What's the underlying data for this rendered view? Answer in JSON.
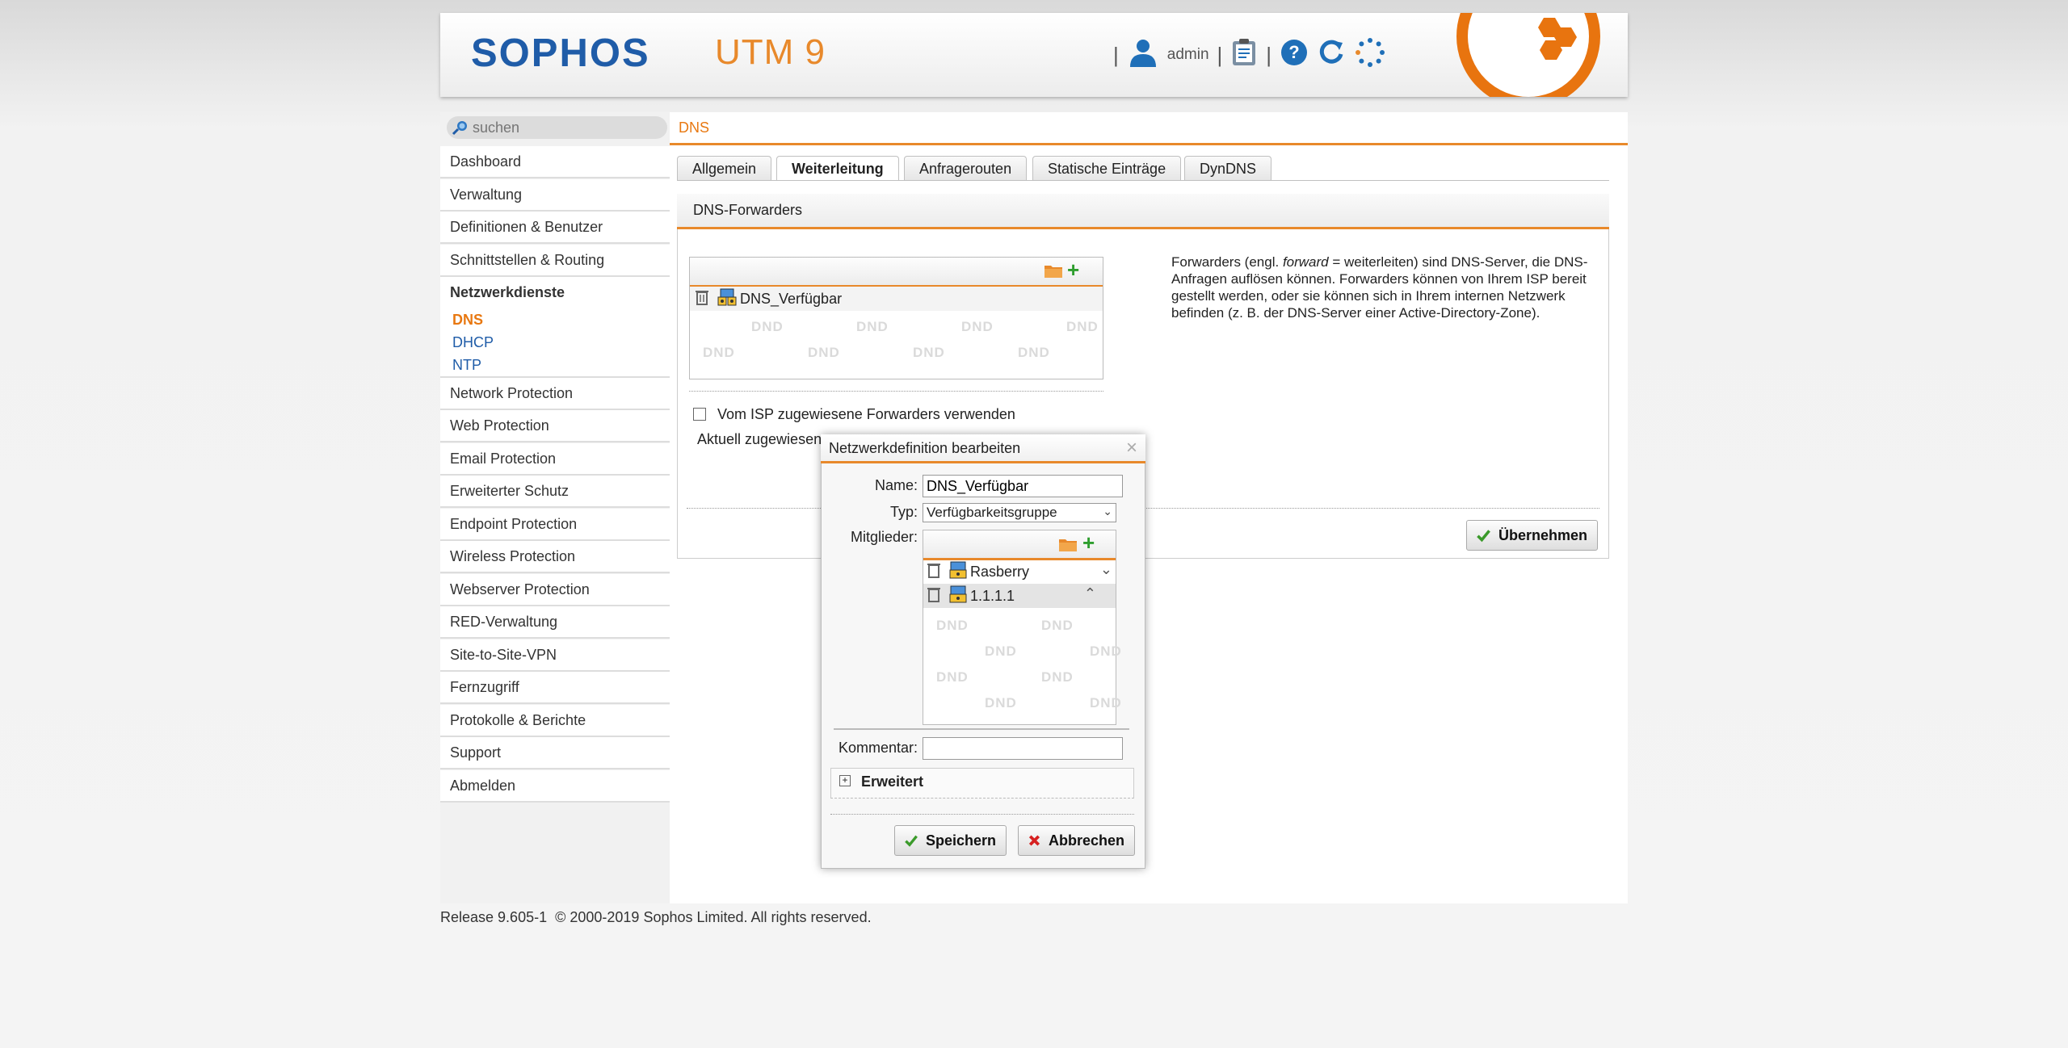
{
  "header": {
    "logo": "SOPHOS",
    "product": "UTM 9",
    "user": "admin"
  },
  "search": {
    "placeholder": "suchen"
  },
  "breadcrumb": "DNS",
  "sidebar": {
    "items": [
      {
        "label": "Dashboard"
      },
      {
        "label": "Verwaltung"
      },
      {
        "label": "Definitionen & Benutzer"
      },
      {
        "label": "Schnittstellen & Routing"
      },
      {
        "label": "Netzwerkdienste"
      },
      {
        "label": "Network Protection"
      },
      {
        "label": "Web Protection"
      },
      {
        "label": "Email Protection"
      },
      {
        "label": "Erweiterter Schutz"
      },
      {
        "label": "Endpoint Protection"
      },
      {
        "label": "Wireless Protection"
      },
      {
        "label": "Webserver Protection"
      },
      {
        "label": "RED-Verwaltung"
      },
      {
        "label": "Site-to-Site-VPN"
      },
      {
        "label": "Fernzugriff"
      },
      {
        "label": "Protokolle & Berichte"
      },
      {
        "label": "Support"
      },
      {
        "label": "Abmelden"
      }
    ],
    "subitems": [
      {
        "label": "DNS"
      },
      {
        "label": "DHCP"
      },
      {
        "label": "NTP"
      }
    ]
  },
  "tabs": [
    {
      "label": "Allgemein"
    },
    {
      "label": "Weiterleitung"
    },
    {
      "label": "Anfragerouten"
    },
    {
      "label": "Statische Einträge"
    },
    {
      "label": "DynDNS"
    }
  ],
  "panel": {
    "title": "DNS-Forwarders",
    "list_item": "DNS_Verfügbar",
    "dnd": "DND",
    "checkbox_label": "Vom ISP zugewiesene Forwarders verwenden",
    "assigned_label": "Aktuell zugewiesen",
    "help_pre": "Forwarders (engl. ",
    "help_em": "forward",
    "help_post": " = weiterleiten) sind DNS-Server, die DNS-Anfragen auflösen können. Forwarders können von Ihrem ISP bereit gestellt werden, oder sie können sich in Ihrem internen Netzwerk befinden (z. B. der DNS-Server einer Active-Directory-Zone).",
    "apply_button": "Übernehmen"
  },
  "dialog": {
    "title": "Netzwerkdefinition bearbeiten",
    "name_label": "Name:",
    "name_value": "DNS_Verfügbar",
    "type_label": "Typ:",
    "type_value": "Verfügbarkeitsgruppe",
    "members_label": "Mitglieder:",
    "members": [
      {
        "label": "Rasberry"
      },
      {
        "label": "1.1.1.1"
      }
    ],
    "comment_label": "Kommentar:",
    "comment_value": "",
    "advanced_label": "Erweitert",
    "save_button": "Speichern",
    "cancel_button": "Abbrechen"
  },
  "footer": "Release 9.605-1  © 2000-2019 Sophos Limited. All rights reserved.",
  "colors": {
    "accent": "#e8892b",
    "brand_blue": "#1f5ca8",
    "link": "#e87811"
  }
}
